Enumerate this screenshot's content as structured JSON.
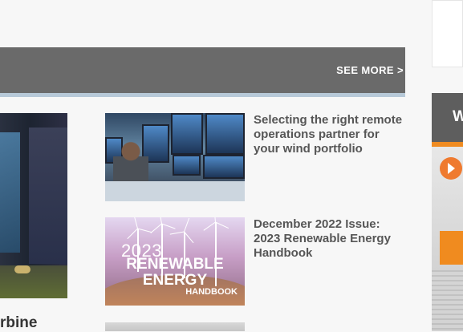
{
  "section": {
    "see_more_label": "SEE MORE >"
  },
  "feature": {
    "title": "rbine"
  },
  "articles": [
    {
      "title": "Selecting the right remote operations partner for your wind portfolio"
    },
    {
      "title": "December 2022 Issue: 2023 Renewable Energy Handbook",
      "thumbnail_text": {
        "year": "2023",
        "main": "RENEWABLE ENERGY",
        "sub": "HANDBOOK"
      }
    },
    {
      "title": ""
    }
  ],
  "sidebar_promo": {
    "header_text": "W"
  },
  "colors": {
    "section_bar": "#6a6a6a",
    "accent_underline": "#b7c9d8",
    "text_dark": "#565656",
    "orange": "#ef8b21"
  }
}
